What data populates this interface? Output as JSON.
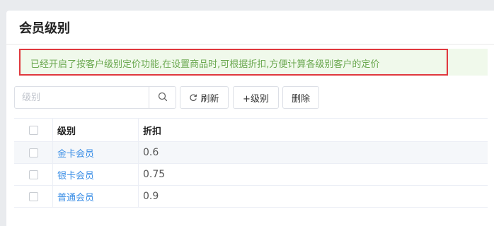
{
  "page": {
    "title": "会员级别"
  },
  "notice": {
    "text": "已经开启了按客户级别定价功能,在设置商品时,可根据折扣,方便计算各级别客户的定价"
  },
  "toolbar": {
    "search_placeholder": "级别",
    "search_icon": "search-icon",
    "refresh_label": "刷新",
    "add_label": "+级别",
    "delete_label": "删除"
  },
  "table": {
    "columns": [
      "级别",
      "折扣"
    ],
    "rows": [
      {
        "level": "金卡会员",
        "discount": "0.6"
      },
      {
        "level": "银卡会员",
        "discount": "0.75"
      },
      {
        "level": "普通会员",
        "discount": "0.9"
      }
    ]
  },
  "colors": {
    "notice_text": "#6aa84f",
    "notice_bg": "#f0f9eb",
    "highlight_border": "#e0393e",
    "link": "#3a8ee6"
  }
}
